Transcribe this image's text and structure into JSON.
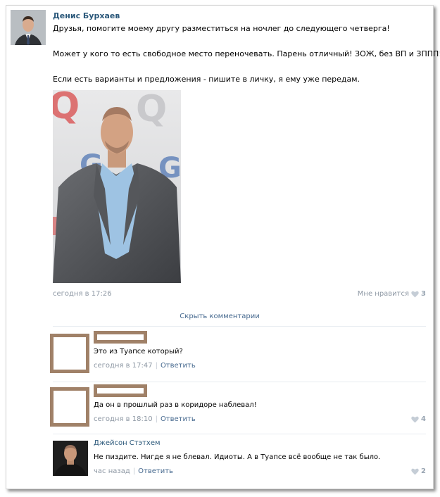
{
  "post": {
    "author": "Денис Бурхаев",
    "paragraphs": [
      "Друзья, помогите моему другу разместиться на ночлег до следующего четверга!",
      "Может у кого то есть свободное место переночевать. Парень отличный! ЗОЖ, без ВП и ЗППП! :))",
      "Если есть варианты и предложения - пишите в личку, я ему уже передам."
    ],
    "time": "сегодня в 17:26",
    "like_label": "Мне нравится",
    "like_count": "3"
  },
  "hide_comments": "Скрыть комментарии",
  "comments": [
    {
      "author": "",
      "text": "Это из Туапсе который?",
      "time": "сегодня в 17:47",
      "reply": "Ответить",
      "likes": ""
    },
    {
      "author": "",
      "text": "Да он в прошлый раз в коридоре наблевал!",
      "time": "сегодня в 18:10",
      "reply": "Ответить",
      "likes": "4"
    },
    {
      "author": "Джейсон Стэтхем",
      "text": "Не пиздите. Нигде я не блевал. Идиоты. А в Туапсе всё вообще не так было.",
      "time": "час назад",
      "reply": "Ответить",
      "likes": "2"
    }
  ],
  "colors": {
    "link": "#2b587a",
    "meta": "#8e98a4",
    "redaction": "#a08168"
  },
  "icons": [
    "heart-icon"
  ]
}
